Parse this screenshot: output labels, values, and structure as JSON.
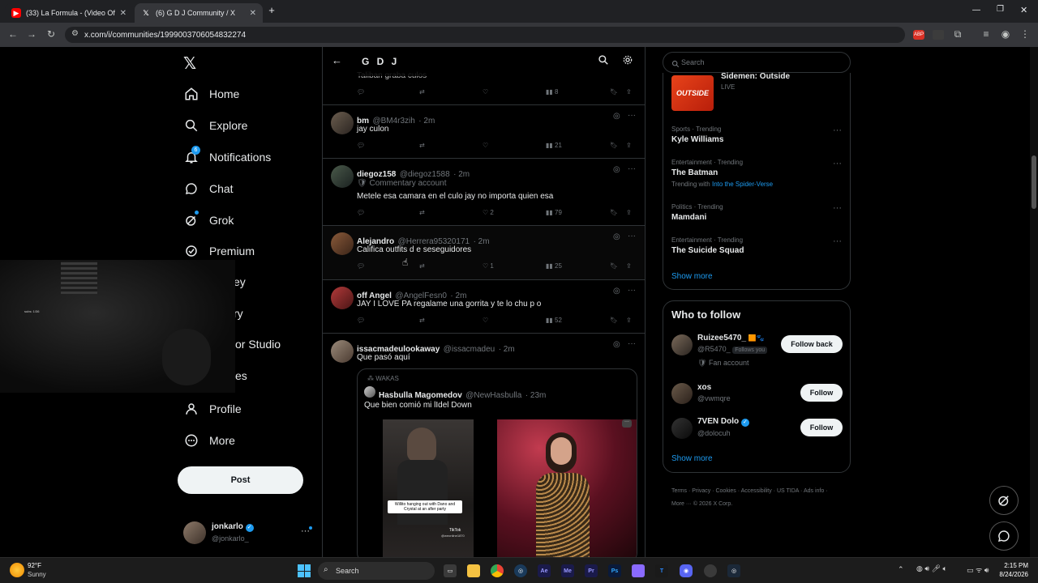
{
  "browser": {
    "tabs": [
      {
        "title": "(33) La Formula - (Video Oficial"
      },
      {
        "title": "(6) G D J Community / X"
      }
    ],
    "url": "x.com/i/communities/1999003706054832274"
  },
  "nav": {
    "items": [
      {
        "label": "Home"
      },
      {
        "label": "Explore"
      },
      {
        "label": "Notifications"
      },
      {
        "label": "Chat"
      },
      {
        "label": "Grok"
      },
      {
        "label": "Premium"
      },
      {
        "label": "ey"
      },
      {
        "label": "ry"
      },
      {
        "label": "or Studio"
      },
      {
        "label": "es"
      },
      {
        "label": "Profile"
      },
      {
        "label": "More"
      }
    ],
    "post_button": "Post",
    "notifications_badge": "6",
    "account": {
      "name": "jonkarlo",
      "handle": "@jonkarlo_"
    },
    "overlay_text": "subs: 1/36"
  },
  "community": {
    "title": "G D J"
  },
  "posts": [
    {
      "text": "Taliban graba culos",
      "views": "8"
    },
    {
      "name": "bm",
      "handle": "@BM4r3zih",
      "time": "· 2m",
      "text": "jay culon",
      "views": "21"
    },
    {
      "name": "diegoz158",
      "handle": "@diegoz1588",
      "time": "· 2m",
      "label": "Commentary account",
      "text": "Metele esa camara en el culo jay no importa quien esa",
      "likes": "2",
      "views": "79"
    },
    {
      "name": "Alejandro",
      "handle": "@Herrera95320171",
      "time": "· 2m",
      "text": "Califica outfits d e seseguidores",
      "likes": "1",
      "views": "25"
    },
    {
      "name": "off Angel",
      "handle": "@AngelFesn0",
      "time": "· 2m",
      "text": "JAY I LOVE PA regalame una gorrita y te lo chu p o",
      "views": "52"
    },
    {
      "name": "issacmadeulookaway",
      "handle": "@issacmadeu",
      "time": "· 2m",
      "text": "Que pasó aquí"
    }
  ],
  "quote": {
    "community": "WAKAS",
    "name": "Hasbulla Magomedov",
    "handle": "@NewHasbulla",
    "time": "· 23m",
    "text": "Que bien comió mi lIdel Down",
    "caption": "Willito hanging out with Dano and Crystal at an after party",
    "tiktok": "TikTok",
    "tiktok_user": "@weonline1870"
  },
  "right": {
    "search_placeholder": "Search",
    "live": {
      "title": "Sidemen: Outside",
      "status": "LIVE",
      "thumb": "OUTSIDE"
    },
    "trends": [
      {
        "category": "Sports · Trending",
        "name": "Kyle Williams"
      },
      {
        "category": "Entertainment · Trending",
        "name": "The Batman",
        "with_label": "Trending with",
        "with_link": "Into the Spider-Verse"
      },
      {
        "category": "Politics · Trending",
        "name": "Mamdani"
      },
      {
        "category": "Entertainment · Trending",
        "name": "The Suicide Squad"
      }
    ],
    "show_more": "Show more",
    "who_to_follow": "Who to follow",
    "follows": [
      {
        "name": "Ruizee5470_",
        "handle": "@R5470_",
        "follows_you": "Follows you",
        "label": "Fan account",
        "button": "Follow back"
      },
      {
        "name": "xos",
        "handle": "@vwmqre",
        "button": "Follow"
      },
      {
        "name": "7VEN Dolo",
        "handle": "@dolocuh",
        "button": "Follow"
      }
    ],
    "show_more_2": "Show more",
    "footer": [
      "Terms",
      "Privacy",
      "Cookies",
      "Accessibility",
      "US TIDA",
      "Ads info",
      "More ···",
      "© 2026 X Corp."
    ]
  },
  "taskbar": {
    "weather_temp": "92°F",
    "weather_desc": "Sunny",
    "search": "Search",
    "time": "2:15 PM",
    "date": "8/24/2026"
  }
}
